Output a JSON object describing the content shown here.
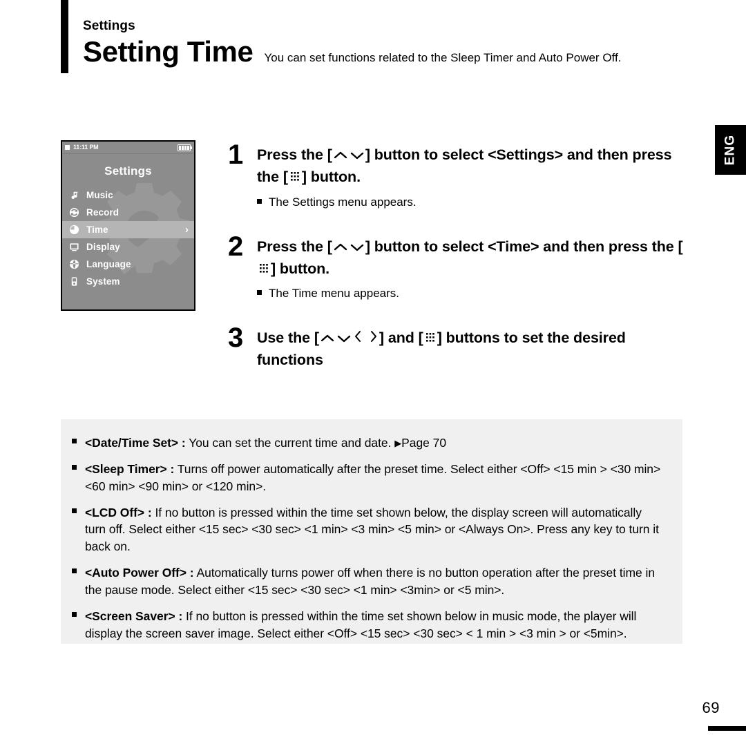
{
  "header": {
    "eyebrow": "Settings",
    "title": "Setting Time",
    "subtitle": "You can set functions related to the Sleep Timer and Auto Power Off."
  },
  "language_tab": {
    "label": "ENG"
  },
  "device": {
    "status": {
      "time": "11:11 PM",
      "play_state_icon": "stop-icon",
      "battery_icon": "battery-full-icon",
      "battery_bars": 4
    },
    "screen_title": "Settings",
    "menu_items": [
      {
        "label": "Music",
        "icon": "music-note-icon",
        "selected": false,
        "has_chevron": false
      },
      {
        "label": "Record",
        "icon": "record-icon",
        "selected": false,
        "has_chevron": false
      },
      {
        "label": "Time",
        "icon": "clock-icon",
        "selected": true,
        "has_chevron": true
      },
      {
        "label": "Display",
        "icon": "monitor-icon",
        "selected": false,
        "has_chevron": false
      },
      {
        "label": "Language",
        "icon": "globe-icon",
        "selected": false,
        "has_chevron": false
      },
      {
        "label": "System",
        "icon": "device-icon",
        "selected": false,
        "has_chevron": false
      }
    ],
    "watermark_icon": "gear-wrench-watermark",
    "chevron_glyph": "›"
  },
  "steps": [
    {
      "number": "1",
      "text_part1": "Press the [",
      "text_part2": "] button to select <Settings> and then press the [",
      "text_part3": "] button.",
      "note": "The Settings menu appears.",
      "glyphs_first": [
        "up-chevron-icon",
        "down-chevron-icon"
      ],
      "glyphs_second": [
        "menu-grid-icon"
      ]
    },
    {
      "number": "2",
      "text_part1": "Press the [",
      "text_part2": "] button to select <Time> and then press the [",
      "text_part3": "] button.",
      "note": "The Time menu appears.",
      "glyphs_first": [
        "up-chevron-icon",
        "down-chevron-icon"
      ],
      "glyphs_second": [
        "menu-grid-icon"
      ]
    },
    {
      "number": "3",
      "text_part1": "Use the [",
      "text_part2": "] and [",
      "text_part3": "] buttons to set the desired functions",
      "note": "",
      "glyphs_first": [
        "up-chevron-icon",
        "down-chevron-icon",
        "left-chevron-icon",
        "right-chevron-icon"
      ],
      "glyphs_second": [
        "menu-grid-icon"
      ]
    }
  ],
  "info_items": [
    {
      "term": "<Date/Time Set> :",
      "body_before_arrow": " You can set the current time and date. ",
      "page_ref": "Page 70",
      "has_page_arrow": true,
      "body": ""
    },
    {
      "term": "<Sleep Timer> :",
      "body": " Turns off power automatically after the preset time. Select either <Off> <15 min > <30 min> <60 min> <90 min> or <120 min>.",
      "has_page_arrow": false
    },
    {
      "term": "<LCD Off> :",
      "body": " If no button is pressed within the time set shown below, the display screen will automatically turn off. Select either <15 sec> <30 sec> <1 min> <3 min> <5 min> or <Always On>. Press any key to turn it back on.",
      "has_page_arrow": false
    },
    {
      "term": "<Auto Power Off> :",
      "body": " Automatically turns power off when there is no button operation after the preset time in the pause mode. Select either <15 sec> <30 sec> <1 min> <3min> or <5 min>.",
      "has_page_arrow": false
    },
    {
      "term": "<Screen Saver> :",
      "body": " If no button is pressed within the time set shown below in music mode, the player will display the screen saver image. Select either <Off> <15 sec> <30 sec> < 1 min > <3 min > or <5min>.",
      "has_page_arrow": false
    }
  ],
  "footer": {
    "page_number": "69"
  },
  "colors": {
    "device_screen_bg": "#8c8c8c",
    "device_selected_row": "#b5b5b5",
    "info_panel_bg": "#f0f0f0",
    "ink": "#000000",
    "tab_bg": "#000000"
  }
}
